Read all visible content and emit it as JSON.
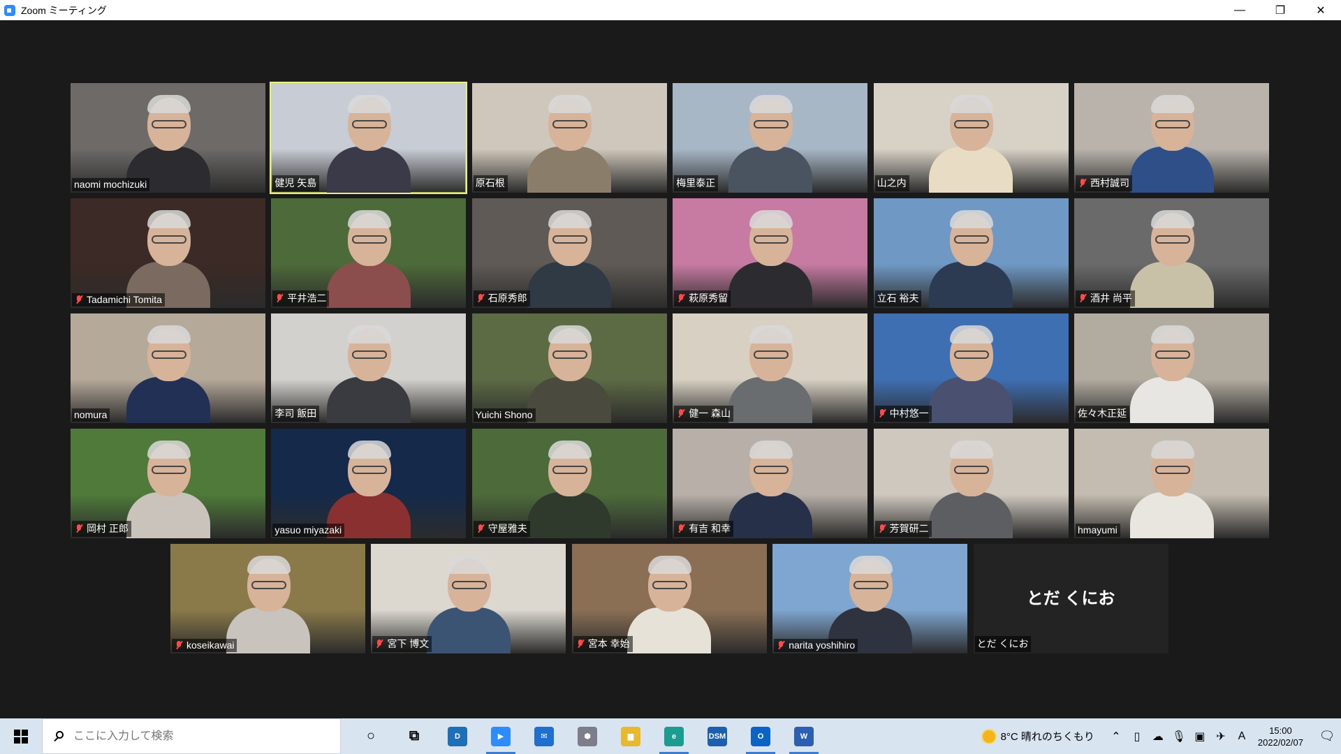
{
  "window": {
    "title": "Zoom ミーティング",
    "minimize": "—",
    "restore": "❐",
    "close": "✕"
  },
  "participants": [
    {
      "name": "naomi mochizuki",
      "muted": false,
      "bg": "#6d6a68",
      "shirt": "#2b2b30"
    },
    {
      "name": "健児 矢島",
      "muted": false,
      "bg": "#c8ccd4",
      "shirt": "#3a3a48",
      "active": true
    },
    {
      "name": "原石根",
      "muted": false,
      "bg": "#cfc7bb",
      "shirt": "#8a7d6a"
    },
    {
      "name": "梅里泰正",
      "muted": false,
      "bg": "#a7b7c6",
      "shirt": "#4a5360"
    },
    {
      "name": "山之内",
      "muted": false,
      "bg": "#d8d1c6",
      "shirt": "#e8dcc5"
    },
    {
      "name": "西村誠司",
      "muted": true,
      "bg": "#b9b3ac",
      "shirt": "#2e4f88"
    },
    {
      "name": "Tadamichi Tomita",
      "muted": true,
      "bg": "#3b2a25",
      "shirt": "#7a6a60"
    },
    {
      "name": "平井浩二",
      "muted": true,
      "bg": "#4d6b3a",
      "shirt": "#8c4d4d"
    },
    {
      "name": "石原秀郎",
      "muted": true,
      "bg": "#5f5a55",
      "shirt": "#2f3a44"
    },
    {
      "name": "萩原秀留",
      "muted": true,
      "bg": "#c77ba2",
      "shirt": "#2c2c30"
    },
    {
      "name": "立石 裕夫",
      "muted": false,
      "bg": "#6f99c4",
      "shirt": "#2d3b52"
    },
    {
      "name": "酒井 尚平",
      "muted": true,
      "bg": "#6b6a6a",
      "shirt": "#c9c0a8"
    },
    {
      "name": "nomura",
      "muted": false,
      "bg": "#b5a99a",
      "shirt": "#223055"
    },
    {
      "name": "李司 飯田",
      "muted": false,
      "bg": "#d3d1cd",
      "shirt": "#3a3b40"
    },
    {
      "name": "Yuichi Shono",
      "muted": false,
      "bg": "#5d6b45",
      "shirt": "#4a4a3e"
    },
    {
      "name": "健一 森山",
      "muted": true,
      "bg": "#d7d0c3",
      "shirt": "#6a6d70"
    },
    {
      "name": "中村悠一",
      "muted": true,
      "bg": "#3f6fb3",
      "shirt": "#4a5070"
    },
    {
      "name": "佐々木正延",
      "muted": false,
      "bg": "#b1aba0",
      "shirt": "#e7e6e3"
    },
    {
      "name": "岡村 正郎",
      "muted": true,
      "bg": "#4f7a3a",
      "shirt": "#c9c3bb"
    },
    {
      "name": "yasuo miyazaki",
      "muted": false,
      "bg": "#152a4a",
      "shirt": "#8a3030"
    },
    {
      "name": "守屋雅夫",
      "muted": true,
      "bg": "#4d6a3b",
      "shirt": "#2f3a2c"
    },
    {
      "name": "有吉 和幸",
      "muted": true,
      "bg": "#b8b0a8",
      "shirt": "#263048"
    },
    {
      "name": "芳賀研二",
      "muted": true,
      "bg": "#cfc8bf",
      "shirt": "#5c5e62"
    },
    {
      "name": "hmayumi",
      "muted": false,
      "bg": "#c4bcb0",
      "shirt": "#e9e6df"
    },
    {
      "name": "koseikawai",
      "muted": true,
      "bg": "#8a7a4a",
      "shirt": "#c8c3bc"
    },
    {
      "name": "宮下 博文",
      "muted": true,
      "bg": "#dcd8d0",
      "shirt": "#3b5474"
    },
    {
      "name": "宮本 幸始",
      "muted": true,
      "bg": "#8a6f55",
      "shirt": "#e6e2d8"
    },
    {
      "name": "narita yoshihiro",
      "muted": true,
      "bg": "#7fa6d0",
      "shirt": "#2f3340"
    },
    {
      "name": "とだ くにお",
      "muted": false,
      "noVideo": true,
      "centerName": "とだ くにお"
    }
  ],
  "taskbar": {
    "search_placeholder": "ここに入力して検索",
    "apps": [
      {
        "icon": "cortana-icon",
        "glyph": "○",
        "color": "transparent",
        "running": false
      },
      {
        "icon": "task-view-icon",
        "glyph": "⧉",
        "color": "transparent",
        "running": false
      },
      {
        "icon": "dell-icon",
        "glyph": "D",
        "color": "#1e6fb9",
        "running": false
      },
      {
        "icon": "zoom-icon",
        "glyph": "▶",
        "color": "#2d8cff",
        "running": true
      },
      {
        "icon": "mail-icon",
        "glyph": "✉",
        "color": "#1f6fd1",
        "running": false
      },
      {
        "icon": "app-hexagon-icon",
        "glyph": "⬢",
        "color": "#7d7d8c",
        "running": false
      },
      {
        "icon": "file-explorer-icon",
        "glyph": "▆",
        "color": "#e8b92e",
        "running": false
      },
      {
        "icon": "edge-icon",
        "glyph": "e",
        "color": "#1a9c8e",
        "running": true
      },
      {
        "icon": "dsm-icon",
        "glyph": "DSM",
        "color": "#1c5fb0",
        "running": false
      },
      {
        "icon": "outlook-icon",
        "glyph": "O",
        "color": "#0b63c6",
        "running": true
      },
      {
        "icon": "word-icon",
        "glyph": "W",
        "color": "#2b5fb3",
        "running": true
      }
    ],
    "weather": "8°C  晴れのちくもり",
    "time": "15:00",
    "date": "2022/02/07",
    "ime": "A"
  }
}
